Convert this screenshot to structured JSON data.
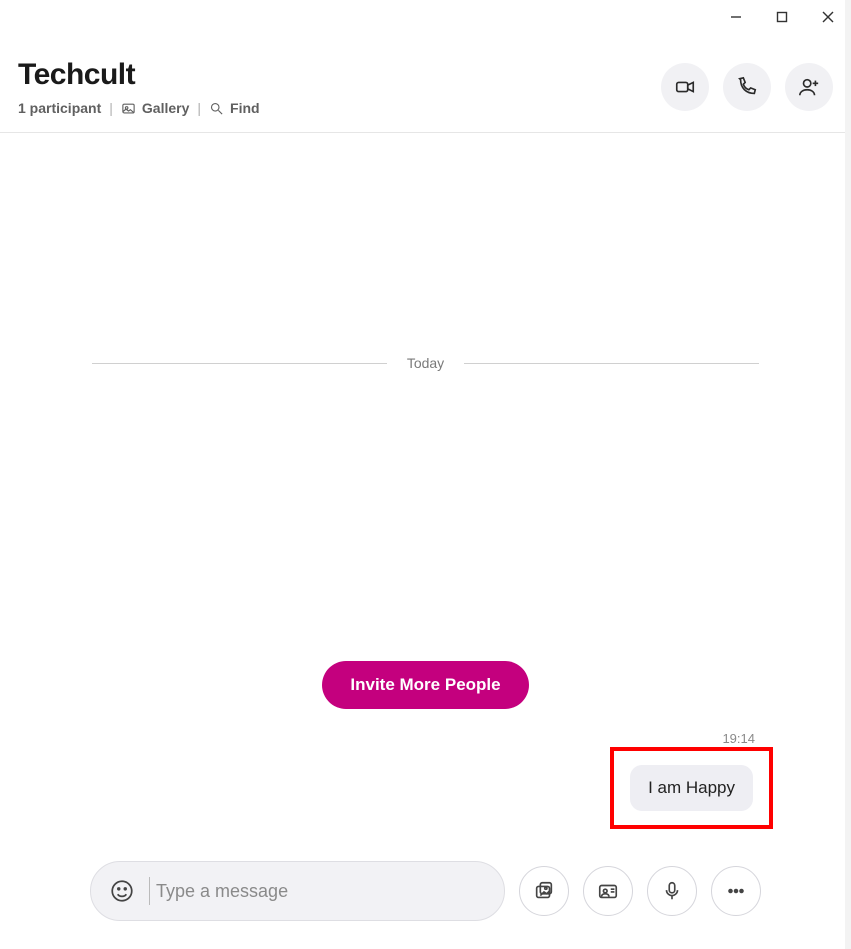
{
  "window": {
    "minimize_title": "Minimize",
    "maximize_title": "Maximize",
    "close_title": "Close"
  },
  "header": {
    "title": "Techcult",
    "participants": "1 participant",
    "gallery_label": "Gallery",
    "find_label": "Find",
    "video_call_title": "Video call",
    "audio_call_title": "Audio call",
    "add_people_title": "Add people"
  },
  "conversation": {
    "date_label": "Today",
    "invite_button": "Invite More People",
    "messages": [
      {
        "time": "19:14",
        "text": "I am Happy",
        "outgoing": true,
        "highlighted": true
      }
    ]
  },
  "composer": {
    "placeholder": "Type a message",
    "emoji_title": "Emoji",
    "attach_title": "Add files",
    "contact_card_title": "Share contact",
    "mic_title": "Record voice message",
    "more_title": "More"
  }
}
